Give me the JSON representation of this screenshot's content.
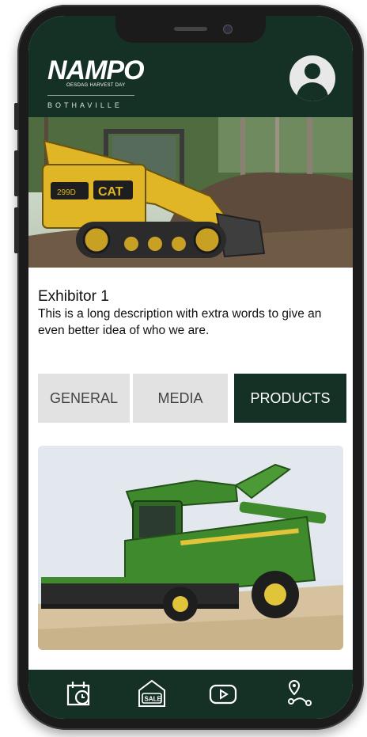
{
  "app": {
    "logo_text": "NAMPO",
    "logo_sub": "OESDAG HARVEST DAY",
    "location": "BOTHAVILLE"
  },
  "exhibitor": {
    "name": "Exhibitor 1",
    "description": "This is a long description with extra words to give an even better idea of who we are."
  },
  "hero": {
    "brand_text": "CAT",
    "model_text": "299D"
  },
  "tabs": [
    {
      "label": "GENERAL",
      "active": false
    },
    {
      "label": "MEDIA",
      "active": false
    },
    {
      "label": "PRODUCTS",
      "active": true
    }
  ],
  "bottom_nav": [
    {
      "icon": "schedule-calendar-icon"
    },
    {
      "icon": "sale-tag-icon",
      "label": "SALE"
    },
    {
      "icon": "video-play-icon"
    },
    {
      "icon": "route-map-icon"
    }
  ],
  "colors": {
    "primary": "#153126",
    "tab_inactive": "#e2e2e2",
    "machine_yellow": "#e0b526",
    "machine_green": "#3f8a2c"
  }
}
